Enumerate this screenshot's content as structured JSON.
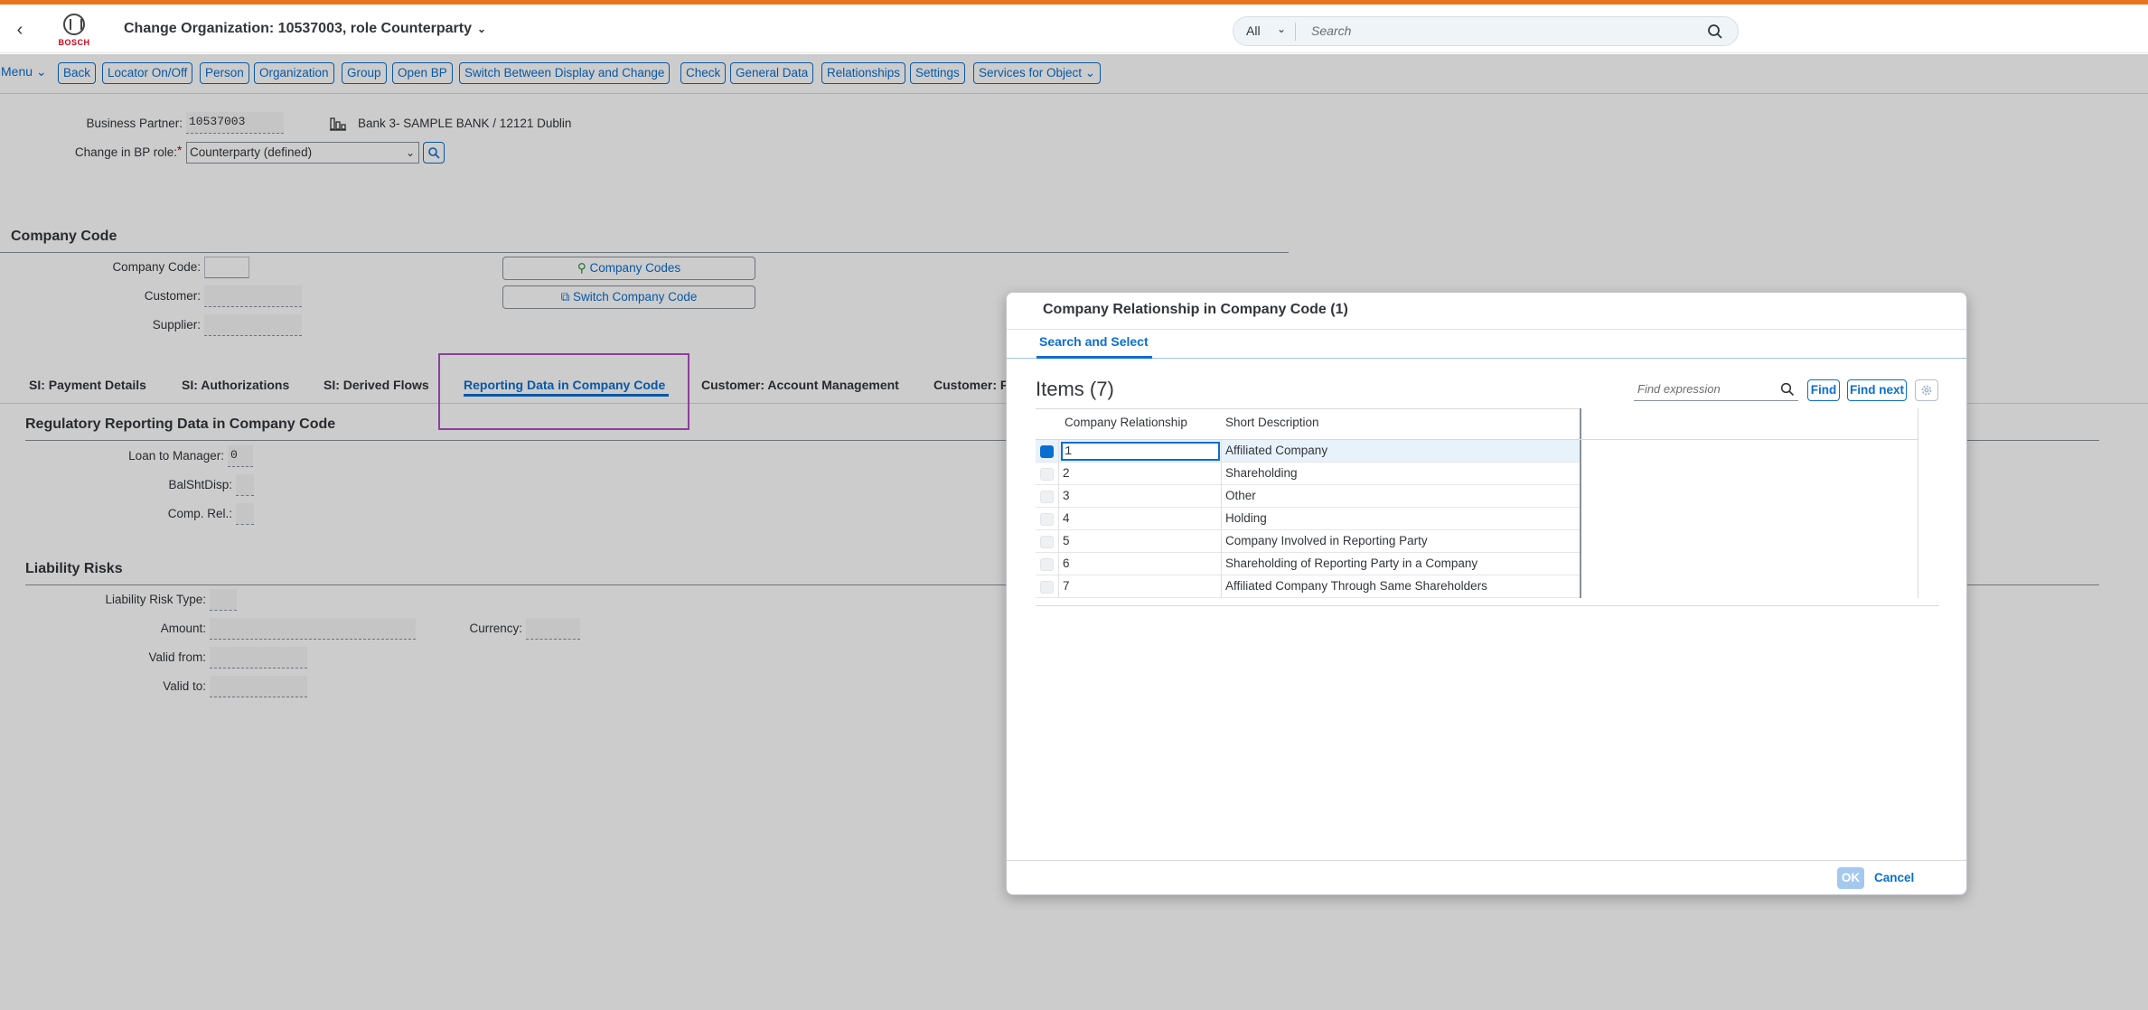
{
  "shell": {
    "title": "Change Organization: 10537003, role Counterparty",
    "logo_text": "BOSCH",
    "search_scope": "All",
    "search_placeholder": "Search"
  },
  "toolbar": {
    "menu": "Menu",
    "buttons": [
      "Back",
      "Locator On/Off",
      "Person",
      "Organization",
      "Group",
      "Open BP",
      "Switch Between Display and Change",
      "Check",
      "General Data",
      "Relationships",
      "Settings",
      "Services for Object"
    ]
  },
  "header": {
    "bp_label": "Business Partner:",
    "bp_value": "10537003",
    "bp_description": "Bank 3- SAMPLE BANK / 12121 Dublin",
    "role_label": "Change in BP role:",
    "role_required": "*",
    "role_value": "Counterparty (defined)"
  },
  "company_code": {
    "title": "Company Code",
    "company_code_label": "Company Code:",
    "company_code_value": "",
    "customer_label": "Customer:",
    "supplier_label": "Supplier:",
    "company_codes_button": "Company Codes",
    "switch_button": "Switch Company Code"
  },
  "tabs": [
    "SI: Payment Details",
    "SI: Authorizations",
    "SI: Derived Flows",
    "Reporting Data in Company Code",
    "Customer: Account Management",
    "Customer: F"
  ],
  "regulatory": {
    "title": "Regulatory Reporting Data in Company Code",
    "loan_label": "Loan to Manager:",
    "loan_value": "0",
    "balsht_label": "BalShtDisp:",
    "comprel_label": "Comp. Rel.:"
  },
  "liability": {
    "title": "Liability Risks",
    "type_label": "Liability Risk Type:",
    "amount_label": "Amount:",
    "currency_label": "Currency:",
    "valid_from_label": "Valid from:",
    "valid_to_label": "Valid to:"
  },
  "dialog": {
    "title": "Company Relationship in Company Code (1)",
    "subtab": "Search and Select",
    "items_title": "Items (7)",
    "find_placeholder": "Find expression",
    "find_button": "Find",
    "find_next_button": "Find next",
    "col_relationship": "Company Relationship",
    "col_description": "Short Description",
    "rows": [
      {
        "num": "1",
        "desc": "Affiliated Company"
      },
      {
        "num": "2",
        "desc": "Shareholding"
      },
      {
        "num": "3",
        "desc": "Other"
      },
      {
        "num": "4",
        "desc": "Holding"
      },
      {
        "num": "5",
        "desc": "Company Involved in Reporting Party"
      },
      {
        "num": "6",
        "desc": "Shareholding of Reporting Party in a Company"
      },
      {
        "num": "7",
        "desc": "Affiliated Company Through Same Shareholders"
      }
    ],
    "ok_button": "OK",
    "cancel_button": "Cancel"
  },
  "colors": {
    "accent": "#0a6ed1",
    "top_strip": "#e8761f",
    "highlight_box": "#b04fc4",
    "brand_red": "#d0021b"
  }
}
